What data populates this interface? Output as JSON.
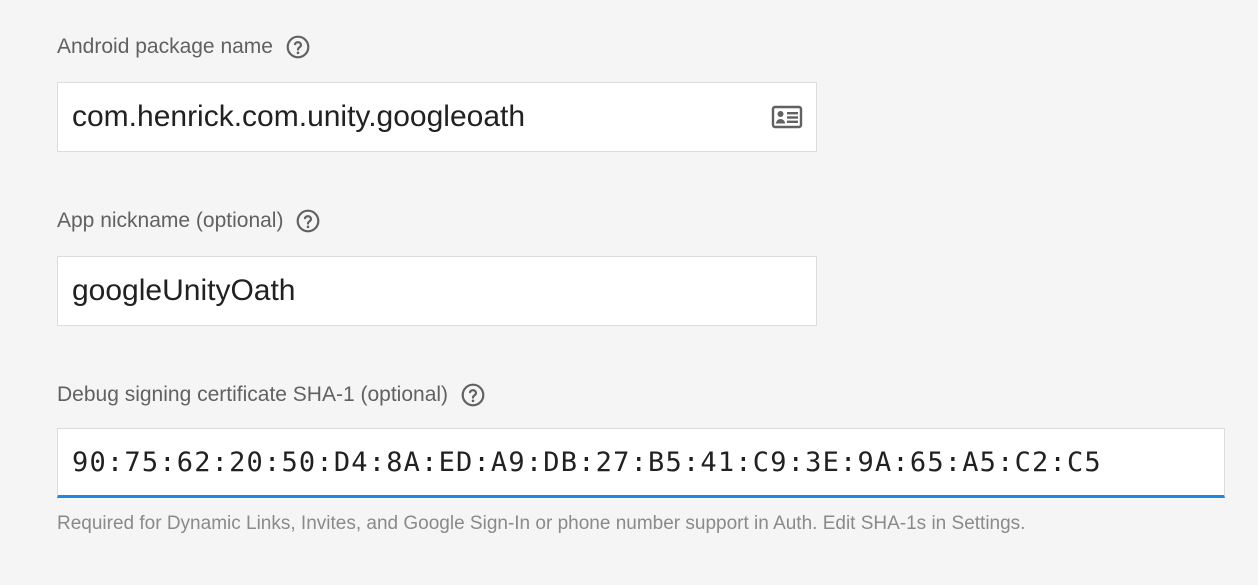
{
  "form": {
    "package_name": {
      "label": "Android package name",
      "value": "com.henrick.com.unity.googleoath",
      "help_icon": "help-circle-icon",
      "trailing_icon": "contact-card-icon"
    },
    "nickname": {
      "label": "App nickname (optional)",
      "value": "googleUnityOath",
      "help_icon": "help-circle-icon"
    },
    "sha1": {
      "label": "Debug signing certificate SHA-1 (optional)",
      "value": "90:75:62:20:50:D4:8A:ED:A9:DB:27:B5:41:C9:3E:9A:65:A5:C2:C5",
      "help_icon": "help-circle-icon",
      "helper_text": "Required for Dynamic Links, Invites, and Google Sign-In or phone number support in Auth. Edit SHA-1s in Settings."
    }
  },
  "colors": {
    "background": "#f5f5f5",
    "label": "#616161",
    "input_text": "#212121",
    "input_border": "#dcdcdc",
    "focus_underline": "#1e88e5",
    "helper": "#8a8a8a"
  }
}
